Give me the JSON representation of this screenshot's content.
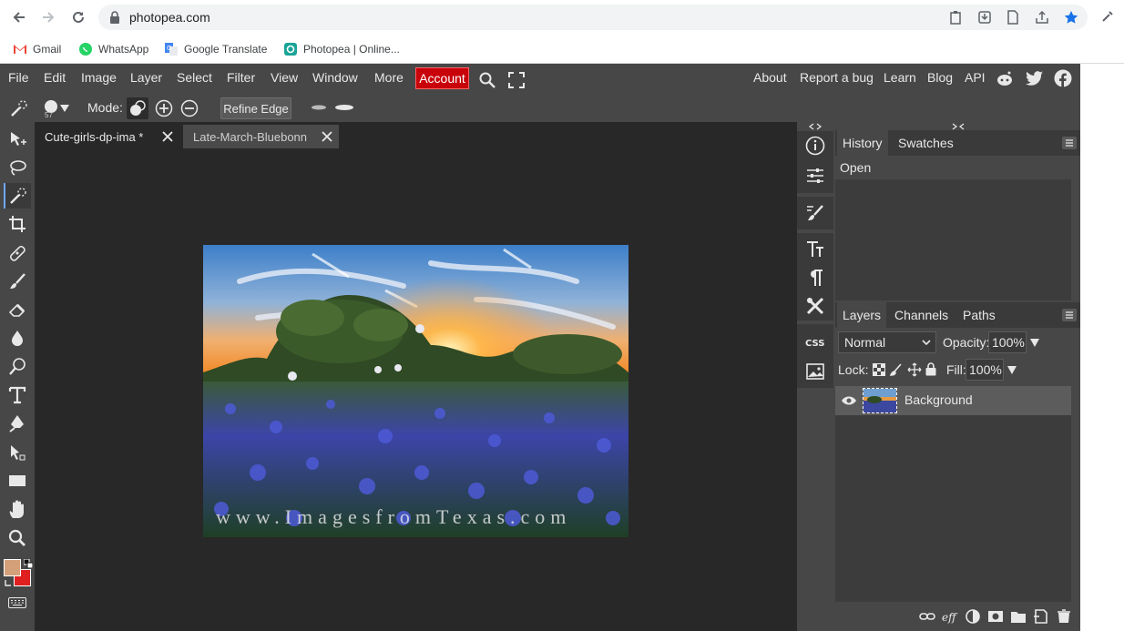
{
  "browser": {
    "url": "photopea.com",
    "bookmarks": [
      {
        "label": "Gmail",
        "icon": "gmail-icon"
      },
      {
        "label": "WhatsApp",
        "icon": "whatsapp-icon"
      },
      {
        "label": "Google Translate",
        "icon": "translate-icon"
      },
      {
        "label": "Photopea | Online...",
        "icon": "photopea-icon"
      }
    ]
  },
  "menubar": {
    "items": [
      "File",
      "Edit",
      "Image",
      "Layer",
      "Select",
      "Filter",
      "View",
      "Window",
      "More"
    ],
    "account": "Account",
    "right_items": [
      "About",
      "Report a bug",
      "Learn",
      "Blog",
      "API"
    ]
  },
  "options": {
    "brush_size": "57",
    "mode_label": "Mode:",
    "refine_edge": "Refine Edge"
  },
  "documents": {
    "tabs": [
      {
        "label": "Cute-girls-dp-ima *",
        "active": true
      },
      {
        "label": "Late-March-Bluebonn",
        "active": false
      }
    ],
    "watermark": "www.ImagesfromTexas.com"
  },
  "history_panel": {
    "tabs": [
      "History",
      "Swatches"
    ],
    "entries": [
      "Open"
    ]
  },
  "layers_panel": {
    "tabs": [
      "Layers",
      "Channels",
      "Paths"
    ],
    "blend_mode": "Normal",
    "opacity_label": "Opacity:",
    "opacity_value": "100%",
    "lock_label": "Lock:",
    "fill_label": "Fill:",
    "fill_value": "100%",
    "layers": [
      {
        "name": "Background",
        "visible": true
      }
    ]
  },
  "colors": {
    "foreground": "#d4a07a",
    "background": "#e02020",
    "accent": "#c8040a",
    "bookmark_star": "#1a73e8"
  }
}
